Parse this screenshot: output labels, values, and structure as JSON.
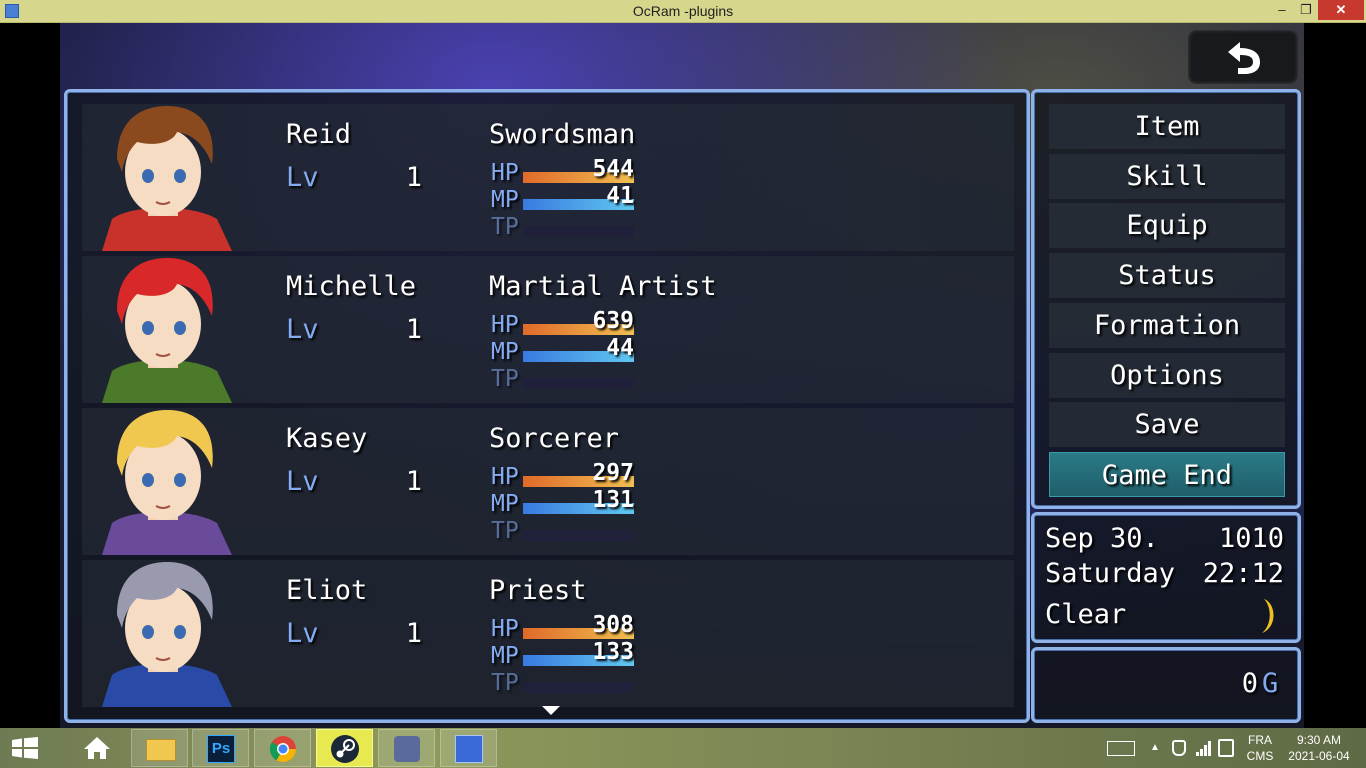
{
  "window": {
    "title": "OcRam -plugins",
    "controls": {
      "minimize": "‒",
      "maximize": "❐",
      "close": "✕"
    }
  },
  "party": [
    {
      "name": "Reid",
      "level_label": "Lv",
      "level": "1",
      "class": "Swordsman",
      "hp_label": "HP",
      "hp": "544",
      "hp_fraction": 1.0,
      "mp_label": "MP",
      "mp": "41",
      "mp_fraction": 1.0,
      "tp_label": "TP",
      "tp_fraction": 0.0,
      "hair": "#8b4a1e",
      "outfit": "#c8322a"
    },
    {
      "name": "Michelle",
      "level_label": "Lv",
      "level": "1",
      "class": "Martial Artist",
      "hp_label": "HP",
      "hp": "639",
      "hp_fraction": 1.0,
      "mp_label": "MP",
      "mp": "44",
      "mp_fraction": 1.0,
      "tp_label": "TP",
      "tp_fraction": 0.0,
      "hair": "#d8282a",
      "outfit": "#4a7a2a"
    },
    {
      "name": "Kasey",
      "level_label": "Lv",
      "level": "1",
      "class": "Sorcerer",
      "hp_label": "HP",
      "hp": "297",
      "hp_fraction": 1.0,
      "mp_label": "MP",
      "mp": "131",
      "mp_fraction": 1.0,
      "tp_label": "TP",
      "tp_fraction": 0.0,
      "hair": "#f0c850",
      "outfit": "#6a4a9a"
    },
    {
      "name": "Eliot",
      "level_label": "Lv",
      "level": "1",
      "class": "Priest",
      "hp_label": "HP",
      "hp": "308",
      "hp_fraction": 1.0,
      "mp_label": "MP",
      "mp": "133",
      "mp_fraction": 1.0,
      "tp_label": "TP",
      "tp_fraction": 0.0,
      "hair": "#9a9aae",
      "outfit": "#2a4aa8"
    }
  ],
  "commands": [
    {
      "label": "Item",
      "selected": false
    },
    {
      "label": "Skill",
      "selected": false
    },
    {
      "label": "Equip",
      "selected": false
    },
    {
      "label": "Status",
      "selected": false
    },
    {
      "label": "Formation",
      "selected": false
    },
    {
      "label": "Options",
      "selected": false
    },
    {
      "label": "Save",
      "selected": false
    },
    {
      "label": "Game End",
      "selected": true
    }
  ],
  "datetime": {
    "date": "Sep 30.",
    "year": "1010",
    "weekday": "Saturday",
    "time": "22:12",
    "weather": "Clear",
    "moon_icon": "crescent-moon-icon",
    "moon_color": "#f0c020"
  },
  "gold": {
    "amount": "0",
    "unit": "G"
  },
  "back_button": {
    "icon": "back-arrow-icon"
  },
  "taskbar": {
    "apps": [
      {
        "name": "start-button"
      },
      {
        "name": "home-icon"
      },
      {
        "name": "file-explorer-icon"
      },
      {
        "name": "photoshop-icon",
        "text": "Ps"
      },
      {
        "name": "chrome-icon"
      },
      {
        "name": "steam-icon"
      },
      {
        "name": "game-app-icon"
      },
      {
        "name": "rpg-maker-icon"
      }
    ],
    "language_top": "FRA",
    "language_bottom": "CMS",
    "time": "9:30 AM",
    "date": "2021-06-04"
  }
}
